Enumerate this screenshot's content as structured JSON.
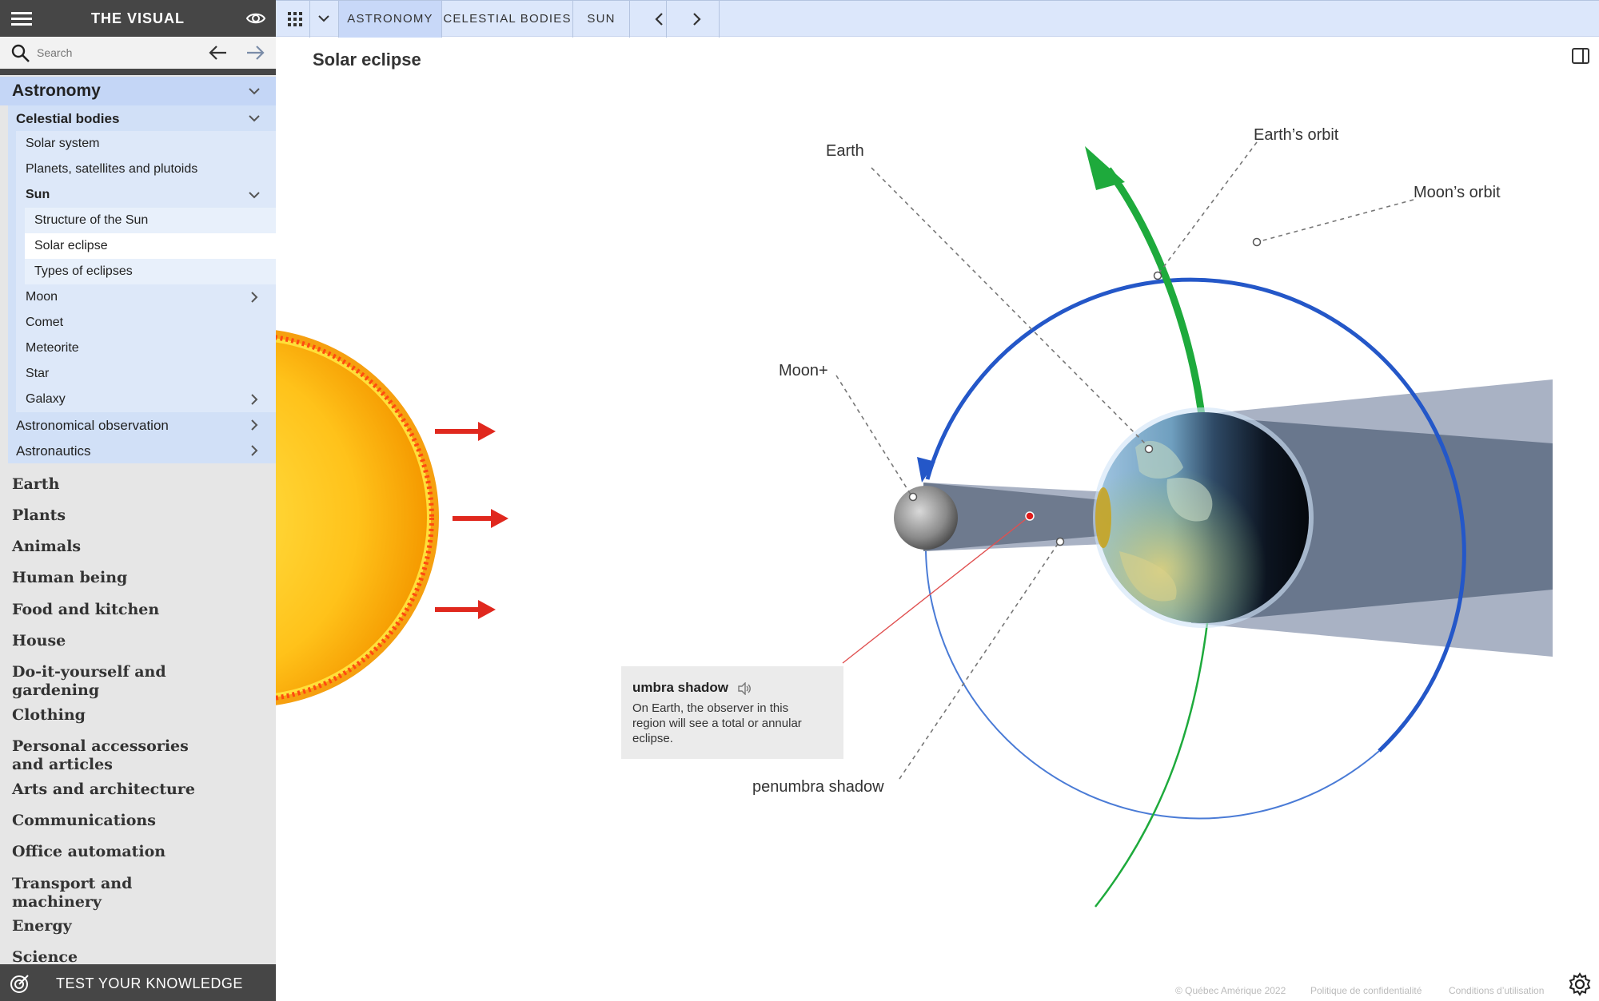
{
  "sidebar": {
    "brand": "THE VISUAL",
    "search_placeholder": "Search",
    "tree": {
      "astronomy": "Astronomy",
      "celestial_bodies": "Celestial bodies",
      "solar_system": "Solar system",
      "planets": "Planets, satellites and plutoids",
      "sun": "Sun",
      "structure_of_sun": "Structure of the Sun",
      "solar_eclipse": "Solar eclipse",
      "types_of_eclipses": "Types of eclipses",
      "moon": "Moon",
      "comet": "Comet",
      "meteorite": "Meteorite",
      "star": "Star",
      "galaxy": "Galaxy",
      "astronomical_observation": "Astronomical observation",
      "astronautics": "Astronautics"
    },
    "categories": {
      "earth": "Earth",
      "plants": "Plants",
      "animals": "Animals",
      "human_being": "Human being",
      "food_kitchen": "Food and kitchen",
      "house": "House",
      "diy_1": "Do-it-yourself and",
      "diy_2": "gardening",
      "clothing": "Clothing",
      "personal_1": "Personal accessories",
      "personal_2": "and articles",
      "arts": "Arts and architecture",
      "communications": "Communications",
      "office": "Office automation",
      "transport_1": "Transport and",
      "transport_2": "machinery",
      "energy": "Energy",
      "science": "Science"
    },
    "quiz_label": "TEST YOUR KNOWLEDGE"
  },
  "topbar": {
    "breadcrumbs": [
      "ASTRONOMY",
      "CELESTIAL BODIES",
      "SUN"
    ]
  },
  "main": {
    "title": "Solar eclipse",
    "labels": {
      "earth": "Earth",
      "earths_orbit": "Earth’s orbit",
      "moons_orbit": "Moon’s orbit",
      "moon": "Moon",
      "penumbra": "penumbra shadow"
    },
    "tooltip": {
      "title": "umbra shadow",
      "body_1": "On Earth, the observer in this",
      "body_2": "region will see a total or annular",
      "body_3": "eclipse."
    }
  },
  "footer": {
    "copyright": "© Québec Amérique 2022",
    "privacy": "Politique de confidentialité",
    "terms": "Conditions d’utilisation"
  },
  "colors": {
    "sidebar_dark": "#464646",
    "nav_blue": "#c4d6f6",
    "topbar_blue": "#dce7fb",
    "moon_orbit": "#2457c8",
    "earth_orbit": "#1eaa3c",
    "sun_arrow": "#e0281e",
    "shadow_gray": "#6e7a8e"
  }
}
